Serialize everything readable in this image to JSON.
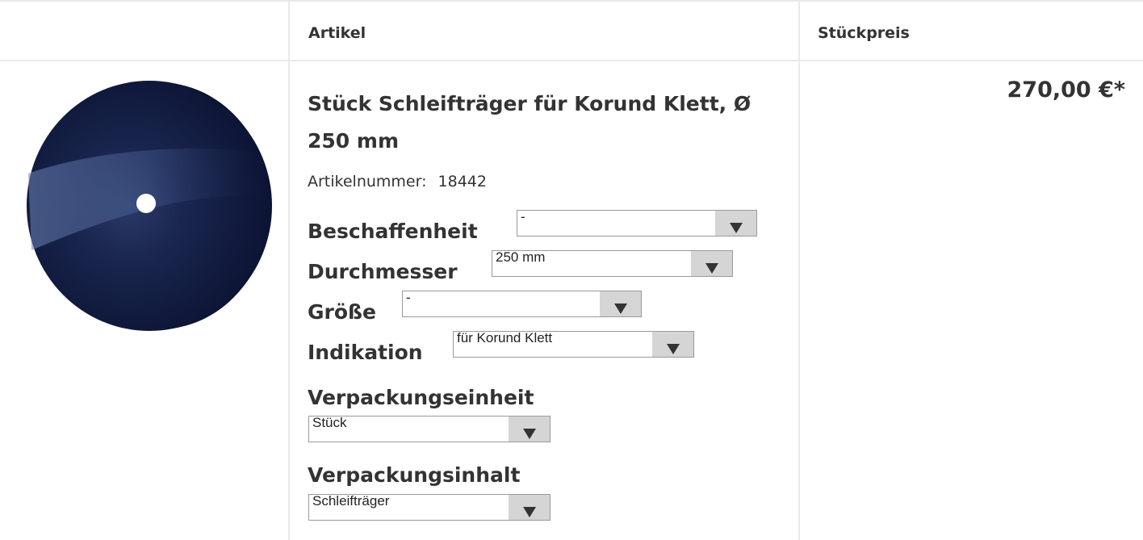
{
  "header": {
    "col_article": "Artikel",
    "col_price": "Stückpreis"
  },
  "product": {
    "title": "Stück Schleifträger für Korund Klett, Ø 250 mm",
    "artnr_label": "Artikelnummer:",
    "artnr_value": "18442",
    "price": "270,00 €*",
    "options": [
      {
        "label": "Beschaffenheit",
        "value": "-"
      },
      {
        "label": "Durchmesser",
        "value": "250 mm"
      },
      {
        "label": "Größe",
        "value": "-"
      },
      {
        "label": "Indikation",
        "value": "für Korund Klett"
      },
      {
        "label": "Verpackungseinheit",
        "value": "Stück"
      },
      {
        "label": "Verpackungsinhalt",
        "value": "Schleifträger"
      }
    ]
  },
  "icons": {
    "dropdown": "triangle-down-icon"
  },
  "colors": {
    "text": "#333333",
    "border": "#e9e9e9",
    "select_button": "#d5d5d5",
    "disc": "#0d1634"
  }
}
